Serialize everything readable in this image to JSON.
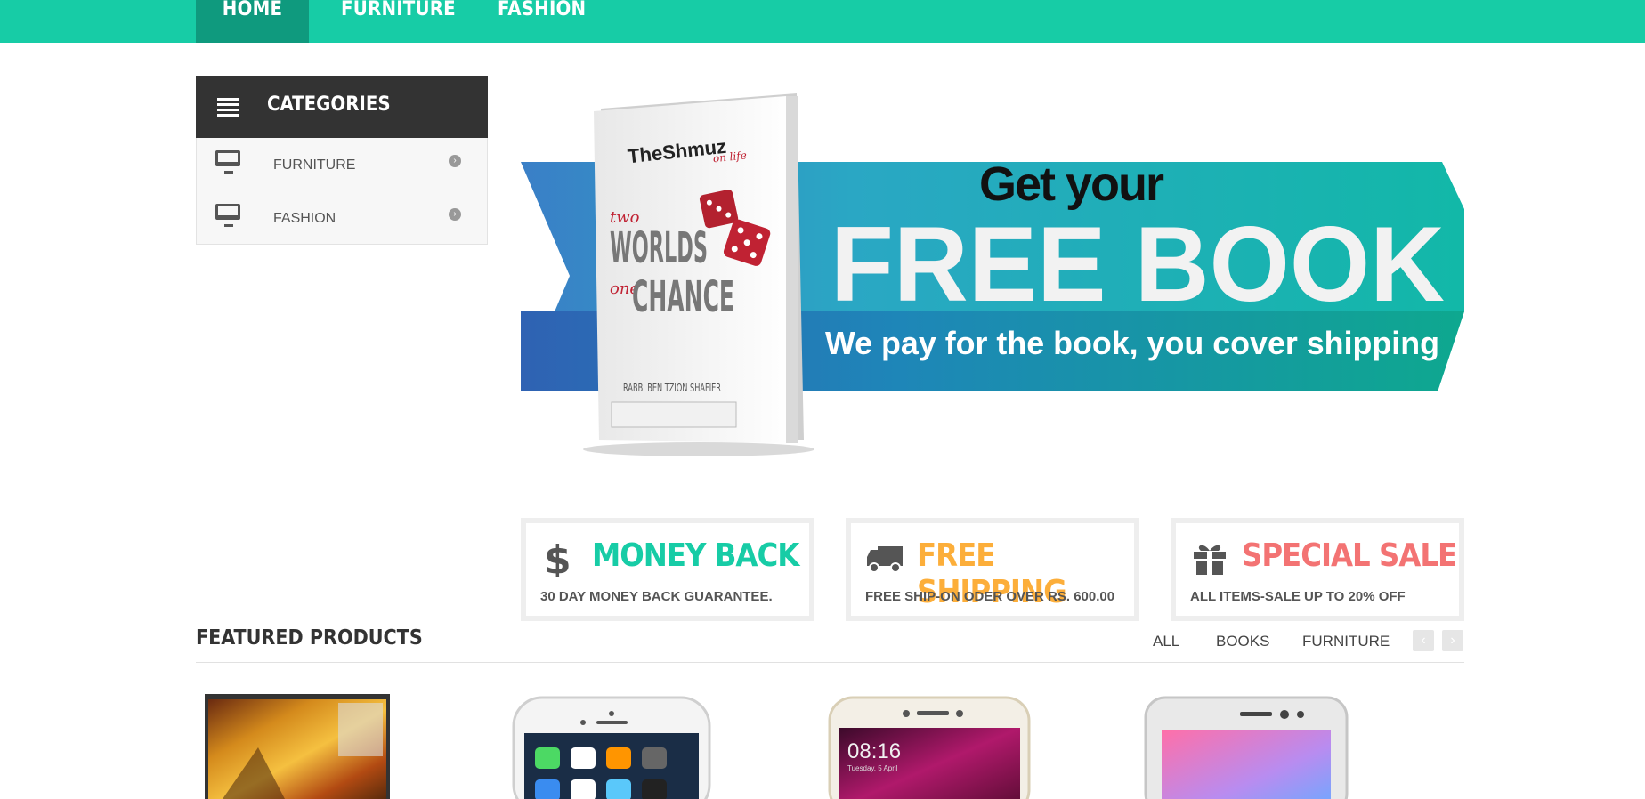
{
  "nav": {
    "home": "HOME",
    "furniture": "FURNITURE",
    "fashion": "FASHION"
  },
  "categories": {
    "title": "CATEGORIES",
    "items": [
      {
        "label": "FURNITURE"
      },
      {
        "label": "FASHION"
      }
    ]
  },
  "banner": {
    "book_brand": "TheShmuz",
    "book_brand_sub": "on life",
    "book_line1_small": "two",
    "book_line1": "WORLDS",
    "book_line2_small": "one",
    "book_line2": "CHANCE",
    "book_author": "RABBI BEN TZION SHAFIER",
    "line1": "Get your",
    "line2": "FREE BOOK",
    "line3": "We pay for the book, you cover shipping"
  },
  "features": [
    {
      "title": "MONEY BACK",
      "subtitle": "30 DAY MONEY BACK GUARANTEE.",
      "icon": "dollar-icon",
      "color": "#17cca6"
    },
    {
      "title": "FREE SHIPPING",
      "subtitle": "FREE SHIP-ON ODER OVER RS. 600.00",
      "icon": "truck-icon",
      "color": "#fcae3a"
    },
    {
      "title": "SPECIAL SALE",
      "subtitle": "ALL ITEMS-SALE UP TO 20% OFF",
      "icon": "gift-icon",
      "color": "#f37373"
    }
  ],
  "featured": {
    "title": "FEATURED PRODUCTS",
    "tabs": [
      "ALL",
      "BOOKS",
      "FURNITURE"
    ],
    "prev": "‹",
    "next": "›"
  },
  "products": [
    {
      "name": "autumn-painting"
    },
    {
      "name": "iphone",
      "screen_time": ""
    },
    {
      "name": "redmi-note-4",
      "time": "08:16",
      "date": "Tuesday, 5 April"
    },
    {
      "name": "lenovo-phone"
    }
  ],
  "colors": {
    "accent": "#17cca6",
    "accent_dark": "#0f9a7e",
    "dark": "#333333"
  }
}
